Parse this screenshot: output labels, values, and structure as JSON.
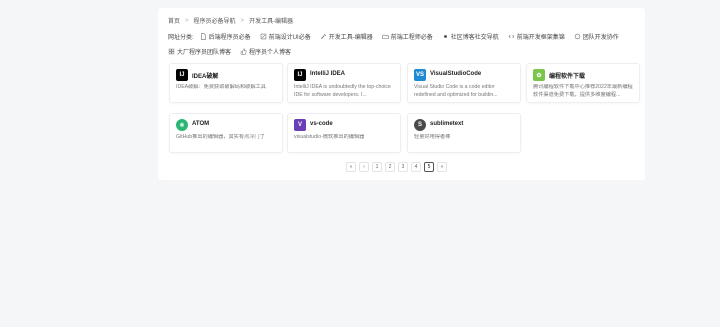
{
  "breadcrumb": [
    "首页",
    "程序员必备导航",
    "开发工具-编辑器"
  ],
  "categories_label": "网址分类:",
  "categories_row1": [
    {
      "label": "后端程序员必备",
      "icon": "document-icon"
    },
    {
      "label": "前端设计UI必备",
      "icon": "edit-icon"
    },
    {
      "label": "开发工具-编辑器",
      "icon": "tools-icon"
    },
    {
      "label": "前端工程师必备",
      "icon": "folder-icon"
    },
    {
      "label": "社区博客社交导航",
      "icon": "dot-icon"
    },
    {
      "label": "前端开发框架集锦",
      "icon": "code-icon"
    },
    {
      "label": "团队开发协作",
      "icon": "circle-icon"
    }
  ],
  "categories_row2": [
    {
      "label": "大厂程序员团队博客",
      "icon": "grid-icon"
    },
    {
      "label": "程序员个人博客",
      "icon": "thumb-icon"
    }
  ],
  "cards": [
    {
      "title": "IDEA破解",
      "desc": "IDEA破解：免费获取破解码和破解工具",
      "logo": "IJ",
      "color": "#000000"
    },
    {
      "title": "IntelliJ IDEA",
      "desc": "IntelliJ IDEA is undoubtedly the top-choice IDE for software developers. I...",
      "logo": "IJ",
      "color": "#000000"
    },
    {
      "title": "VisualStudioCode",
      "desc": "Visual Studio Code is a code editor redefined and optimized for buildin...",
      "logo": "VS",
      "color": "#1f8ad2"
    },
    {
      "title": "编程软件下载",
      "desc": "腾讯编程软件下载中心推荐2022年最新编程软件渠道免费下载，提供多维度编程...",
      "logo": "✿",
      "color": "#7ac64b"
    },
    {
      "title": "ATOM",
      "desc": "GitHub推出的编辑器，其实有点冷门了",
      "logo": "⚛",
      "color": "#2bb673"
    },
    {
      "title": "vs-code",
      "desc": "visualstudio-微软推出的编辑器",
      "logo": "V",
      "color": "#6a3fb5"
    },
    {
      "title": "sublimetext",
      "desc": "轻量好用得者棒",
      "logo": "S",
      "color": "#4a4a4a"
    }
  ],
  "pager": [
    "«",
    "‹",
    "1",
    "2",
    "3",
    "4",
    "5",
    "»"
  ],
  "pager_active": "5"
}
